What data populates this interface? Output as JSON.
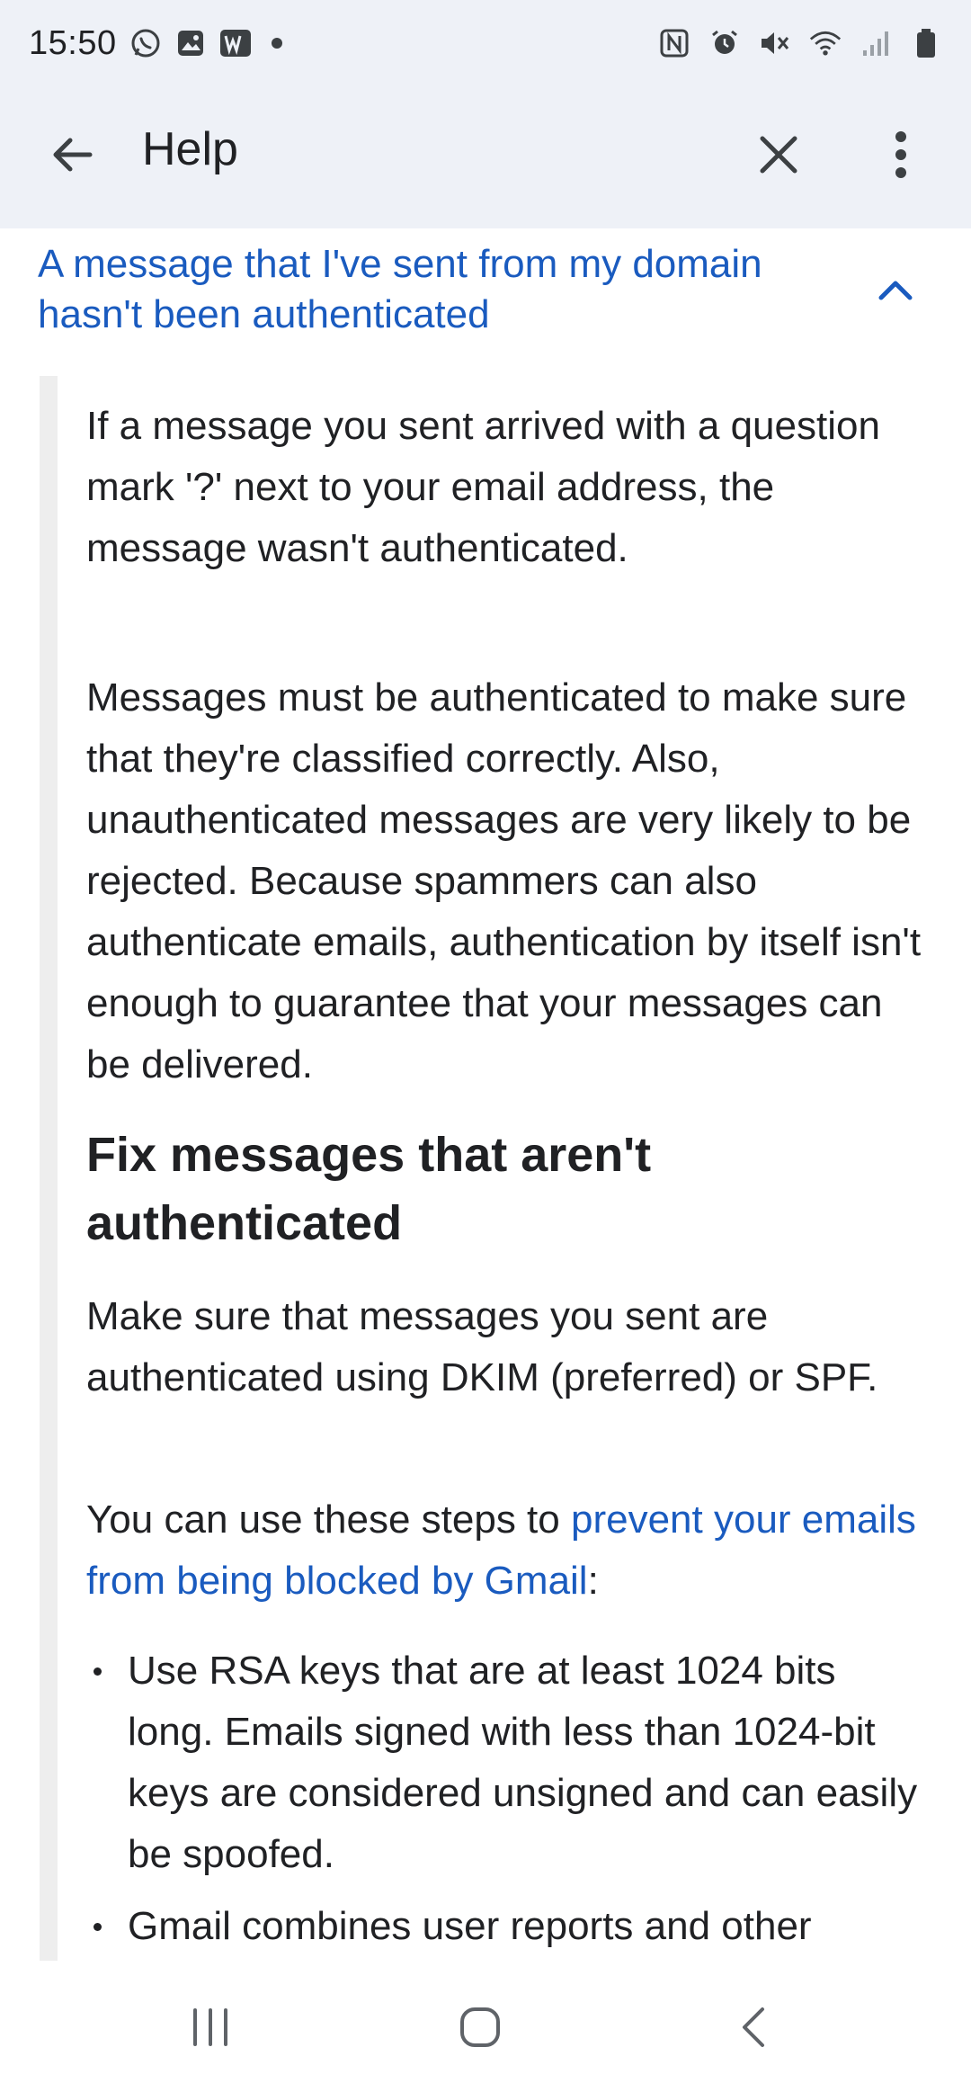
{
  "status_bar": {
    "time": "15:50",
    "left_icons": [
      "whatsapp-icon",
      "gallery-icon",
      "w-app-icon"
    ],
    "right_icons": [
      "nfc-icon",
      "alarm-icon",
      "mute-icon",
      "wifi-icon",
      "signal-icon",
      "battery-icon"
    ],
    "w_label": "W"
  },
  "app_bar": {
    "title": "Help"
  },
  "article": {
    "accordion_title": "A message that I've sent from my domain hasn't been authenticated",
    "paragraph_1": "If a message you sent arrived with a question mark '?' next to your email address, the message wasn't authenticated.",
    "paragraph_2": "Messages must be authenticated to make sure that they're classified correctly. Also, unauthenticated messages are very likely to be rejected. Because spammers can also authenticate emails, authentication by itself isn't enough to guarantee that your messages can be delivered.",
    "heading": "Fix messages that aren't authenticated",
    "paragraph_3": "Make sure that messages you sent are authenticated using DKIM (preferred) or SPF.",
    "paragraph_4_prefix": "You can use these steps to ",
    "paragraph_4_link": "prevent your emails from being blocked by Gmail",
    "paragraph_4_suffix": ":",
    "bullets": [
      "Use RSA keys that are at least 1024 bits long. Emails signed with less than 1024-bit keys are considered unsigned and can easily be spoofed.",
      "Gmail combines user reports and other"
    ]
  },
  "colors": {
    "link": "#1a5bbf",
    "app_bar_bg": "#eef1f7",
    "panel_bar": "#eeeeee"
  }
}
